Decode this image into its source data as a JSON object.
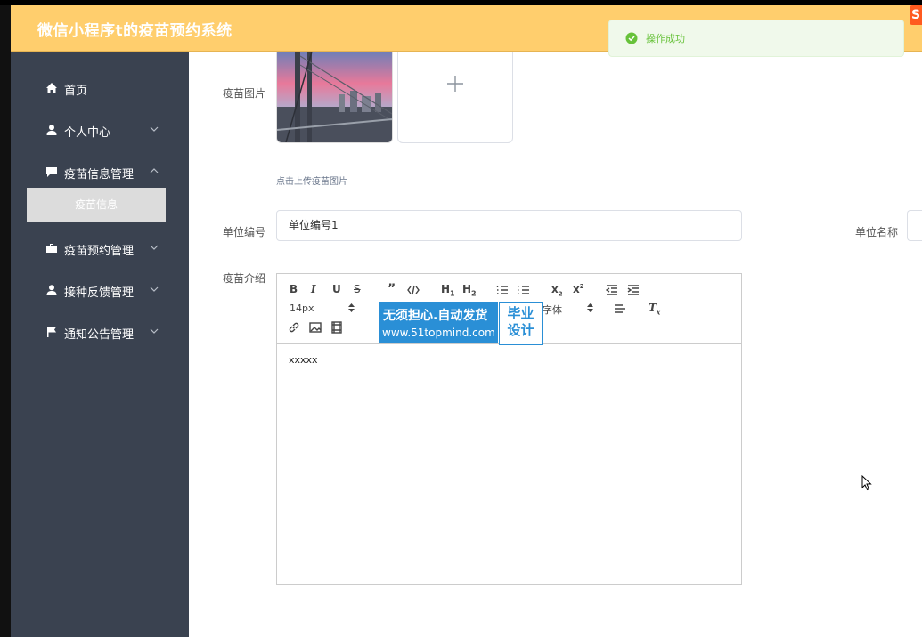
{
  "header": {
    "app_title": "微信小程序t的疫苗预约系统",
    "corner_logo_text": "S"
  },
  "sidebar": {
    "items": [
      {
        "label": "首页",
        "icon": "home-icon"
      },
      {
        "label": "个人中心",
        "icon": "user-icon"
      },
      {
        "label": "疫苗信息管理",
        "icon": "message-icon"
      },
      {
        "label": "疫苗预约管理",
        "icon": "briefcase-icon"
      },
      {
        "label": "接种反馈管理",
        "icon": "user-icon"
      },
      {
        "label": "通知公告管理",
        "icon": "flag-icon"
      }
    ],
    "active_sub": "疫苗信息"
  },
  "form": {
    "image_label": "疫苗图片",
    "upload_hint": "点击上传疫苗图片",
    "unit_code_label": "单位编号",
    "unit_code_value": "单位编号1",
    "unit_name_label": "单位名称",
    "intro_label": "疫苗介绍",
    "font_size_select": "14px",
    "font_family_select": "字体",
    "editor_content": "xxxxx"
  },
  "toast": {
    "message": "操作成功"
  },
  "watermark": {
    "line1": "无须担心.自动发货",
    "line2": "www.51topmind.com",
    "badge": "毕业\n设计"
  },
  "colors": {
    "header_bg": "#ffce6d",
    "sidebar_bg": "#3a4250",
    "success": "#67c23a"
  }
}
